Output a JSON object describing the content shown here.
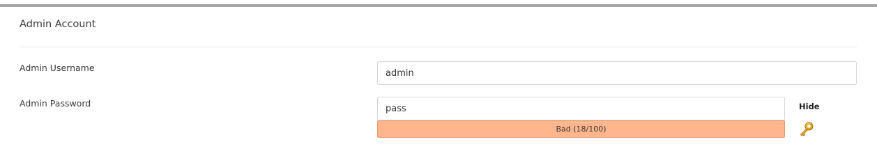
{
  "section": {
    "title": "Admin Account"
  },
  "fields": {
    "username": {
      "label": "Admin Username",
      "value": "admin"
    },
    "password": {
      "label": "Admin Password",
      "value": "pass",
      "visibility_toggle_label": "Hide",
      "generate_icon": "key-icon"
    }
  },
  "password_strength": {
    "label": "Bad (18/100)",
    "score": 18,
    "max": 100,
    "fill_fraction": 1.0,
    "color": "#ffb68c",
    "border_color": "#e79a6a"
  },
  "colors": {
    "top_bar": "#a7a7a7",
    "divider": "#e6e6e6",
    "key_icon": "#e0a31c"
  }
}
